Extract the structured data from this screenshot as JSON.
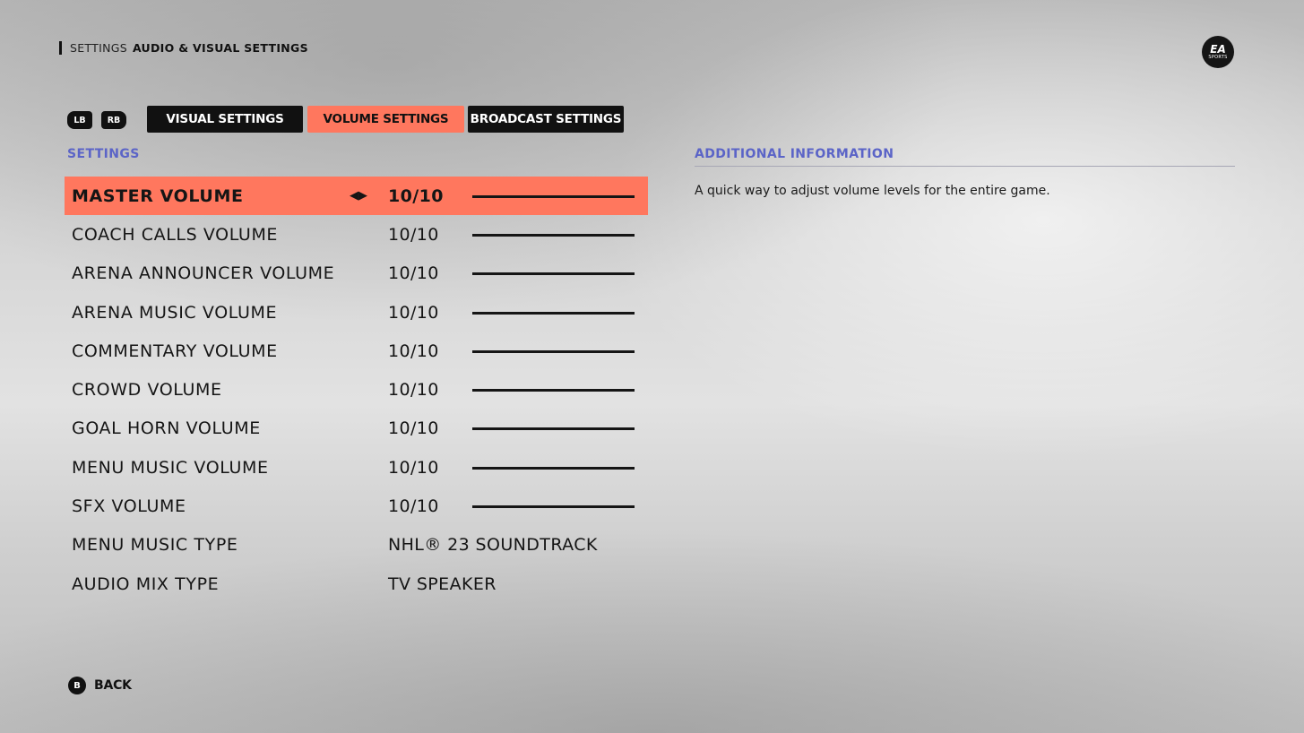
{
  "breadcrumb": {
    "root": "SETTINGS",
    "current": "AUDIO & VISUAL SETTINGS"
  },
  "logo": {
    "main": "EA",
    "sub": "SPORTS"
  },
  "bumpers": {
    "left": "LB",
    "right": "RB"
  },
  "tabs": [
    {
      "label": "VISUAL SETTINGS",
      "active": false
    },
    {
      "label": "VOLUME SETTINGS",
      "active": true
    },
    {
      "label": "BROADCAST SETTINGS",
      "active": false
    }
  ],
  "settings_header": "SETTINGS",
  "info_header": "ADDITIONAL INFORMATION",
  "info_text": "A quick way to adjust volume levels for the entire game.",
  "settings": [
    {
      "label": "MASTER VOLUME",
      "value": "10/10",
      "level": 1.0,
      "selected": true
    },
    {
      "label": "COACH CALLS VOLUME",
      "value": "10/10",
      "level": 1.0
    },
    {
      "label": "ARENA ANNOUNCER VOLUME",
      "value": "10/10",
      "level": 1.0
    },
    {
      "label": "ARENA MUSIC VOLUME",
      "value": "10/10",
      "level": 1.0
    },
    {
      "label": "COMMENTARY VOLUME",
      "value": "10/10",
      "level": 1.0
    },
    {
      "label": "CROWD VOLUME",
      "value": "10/10",
      "level": 1.0
    },
    {
      "label": "GOAL HORN VOLUME",
      "value": "10/10",
      "level": 1.0
    },
    {
      "label": "MENU MUSIC VOLUME",
      "value": "10/10",
      "level": 1.0
    },
    {
      "label": "SFX VOLUME",
      "value": "10/10",
      "level": 1.0
    },
    {
      "label": "MENU MUSIC TYPE",
      "value": "NHL® 23 SOUNDTRACK"
    },
    {
      "label": "AUDIO MIX TYPE",
      "value": "TV SPEAKER"
    }
  ],
  "footer": {
    "button": "B",
    "label": "BACK"
  },
  "colors": {
    "accent": "#ff775e",
    "header": "#5b64c7",
    "dark": "#111111"
  }
}
